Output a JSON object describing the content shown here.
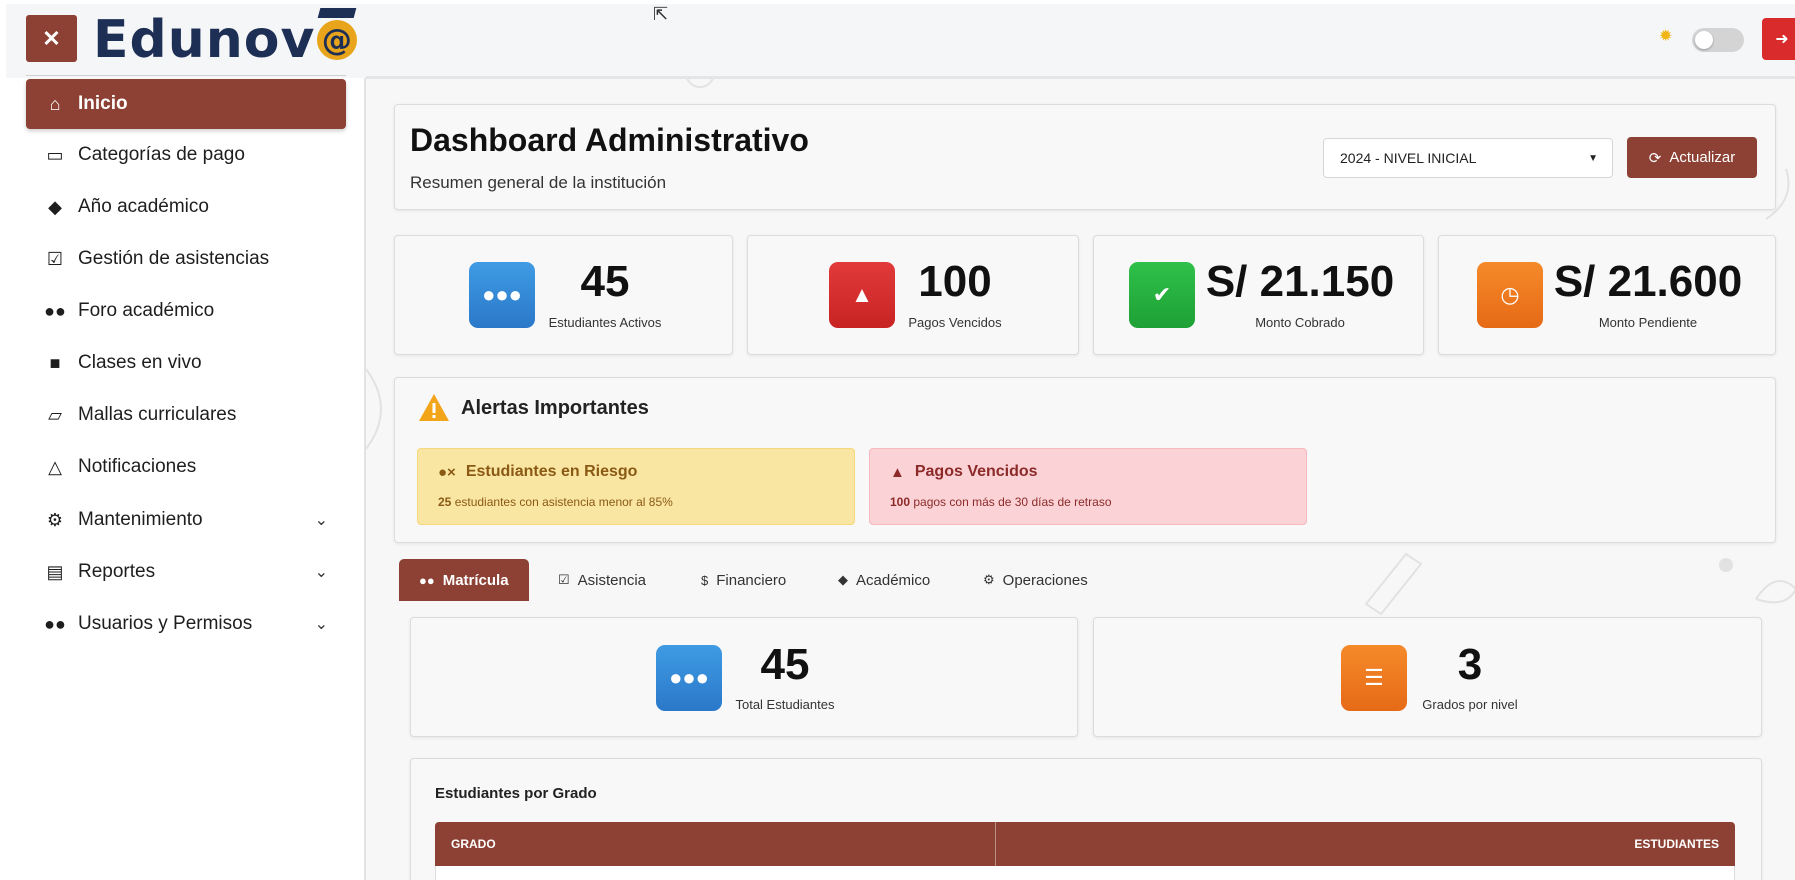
{
  "header": {
    "close_label": "✕",
    "logo_text": "Edunov",
    "logo_suffix": "@"
  },
  "sidebar": {
    "items": [
      {
        "label": "Inicio",
        "icon": "home-icon",
        "active": true
      },
      {
        "label": "Categorías de pago",
        "icon": "money-bill-icon"
      },
      {
        "label": "Año académico",
        "icon": "graduation-cap-icon"
      },
      {
        "label": "Gestión de asistencias",
        "icon": "calendar-check-icon"
      },
      {
        "label": "Foro académico",
        "icon": "users-icon"
      },
      {
        "label": "Clases en vivo",
        "icon": "video-camera-icon"
      },
      {
        "label": "Mallas curriculares",
        "icon": "folder-open-icon"
      },
      {
        "label": "Notificaciones",
        "icon": "bell-icon"
      },
      {
        "label": "Mantenimiento",
        "icon": "cogs-icon",
        "expandable": true
      },
      {
        "label": "Reportes",
        "icon": "file-text-icon",
        "expandable": true
      },
      {
        "label": "Usuarios y Permisos",
        "icon": "users-icon",
        "expandable": true
      }
    ]
  },
  "main": {
    "title": "Dashboard Administrativo",
    "subtitle": "Resumen general de la institución",
    "year_select": "2024 - NIVEL INICIAL",
    "refresh_label": "Actualizar",
    "stats": [
      {
        "value": "45",
        "label": "Estudiantes Activos",
        "icon": "users-icon",
        "color": "#2b78c9"
      },
      {
        "value": "100",
        "label": "Pagos Vencidos",
        "icon": "warning-icon",
        "color": "#c82323"
      },
      {
        "value": "S/ 21.150",
        "label": "Monto Cobrado",
        "icon": "check-circle-icon",
        "color": "#1ea035"
      },
      {
        "value": "S/ 21.600",
        "label": "Monto Pendiente",
        "icon": "clock-icon",
        "color": "#e66a16"
      }
    ],
    "alerts": {
      "title": "Alertas Importantes",
      "items": [
        {
          "title": "Estudiantes en Riesgo",
          "count": "25",
          "desc": " estudiantes con asistencia menor al 85%",
          "icon": "user-times-icon"
        },
        {
          "title": "Pagos Vencidos",
          "count": "100",
          "desc": " pagos con más de 30 días de retraso",
          "icon": "warning-icon"
        }
      ]
    },
    "tabs": [
      {
        "label": "Matrícula",
        "icon": "users-icon",
        "active": true
      },
      {
        "label": "Asistencia",
        "icon": "calendar-check-icon"
      },
      {
        "label": "Financiero",
        "icon": "dollar-icon"
      },
      {
        "label": "Académico",
        "icon": "graduation-cap-icon"
      },
      {
        "label": "Operaciones",
        "icon": "cogs-icon"
      }
    ],
    "tab_stats": [
      {
        "value": "45",
        "label": "Total Estudiantes",
        "icon": "users-icon"
      },
      {
        "value": "3",
        "label": "Grados por nivel",
        "icon": "list-icon"
      }
    ],
    "table": {
      "title": "Estudiantes por Grado",
      "columns": [
        "GRADO",
        "ESTUDIANTES"
      ]
    }
  },
  "colors": {
    "brand": "#8c4134",
    "logo_navy": "#1e2f55",
    "logo_gold": "#e8a51b"
  }
}
